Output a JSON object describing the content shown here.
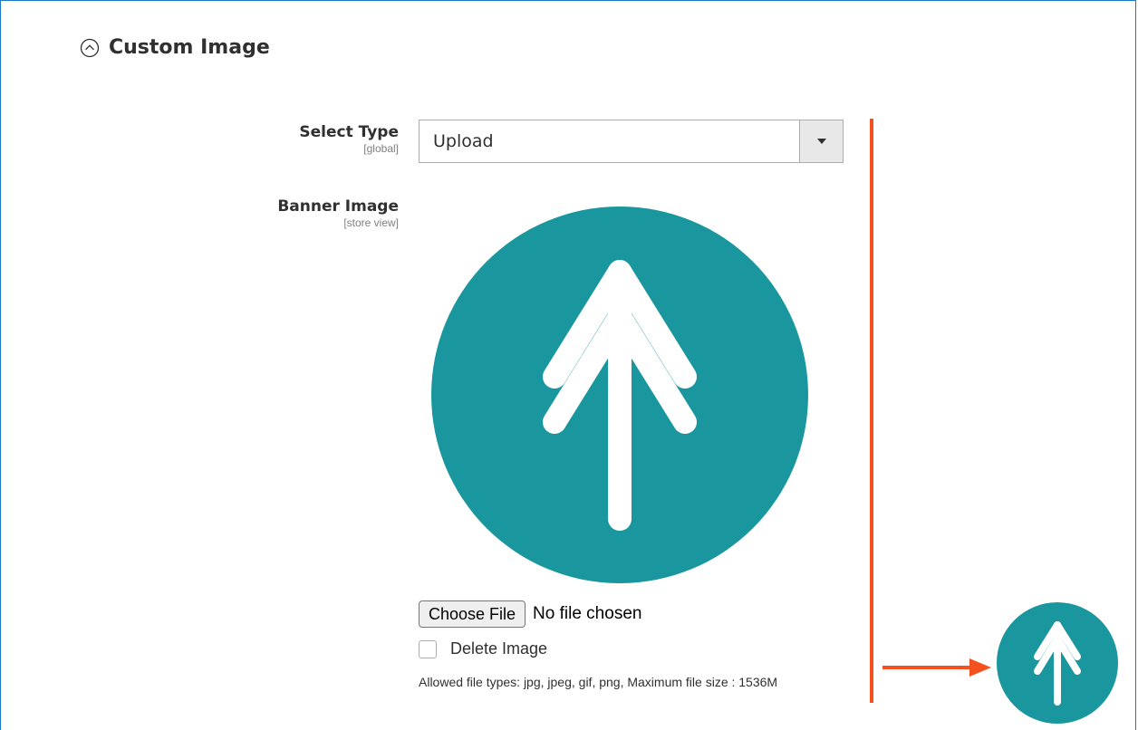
{
  "section": {
    "title": "Custom Image",
    "toggle_icon": "chevron-up-circle-icon"
  },
  "select_type": {
    "label": "Select Type",
    "scope": "[global]",
    "value": "Upload",
    "arrow_icon": "caret-down-icon"
  },
  "banner_image": {
    "label": "Banner Image",
    "scope": "[store view]",
    "preview_icon": "upload-arrow-logo",
    "choose_file_label": "Choose File",
    "file_status": "No file chosen",
    "delete_label": "Delete Image",
    "delete_checked": false,
    "note": "Allowed file types: jpg, jpeg, gif, png, Maximum file size : 1536M"
  },
  "annotation": {
    "color": "#f4511e",
    "thumbnail_icon": "upload-arrow-logo"
  },
  "colors": {
    "logo_teal": "#1a979e",
    "frame_border": "#1979c3"
  }
}
